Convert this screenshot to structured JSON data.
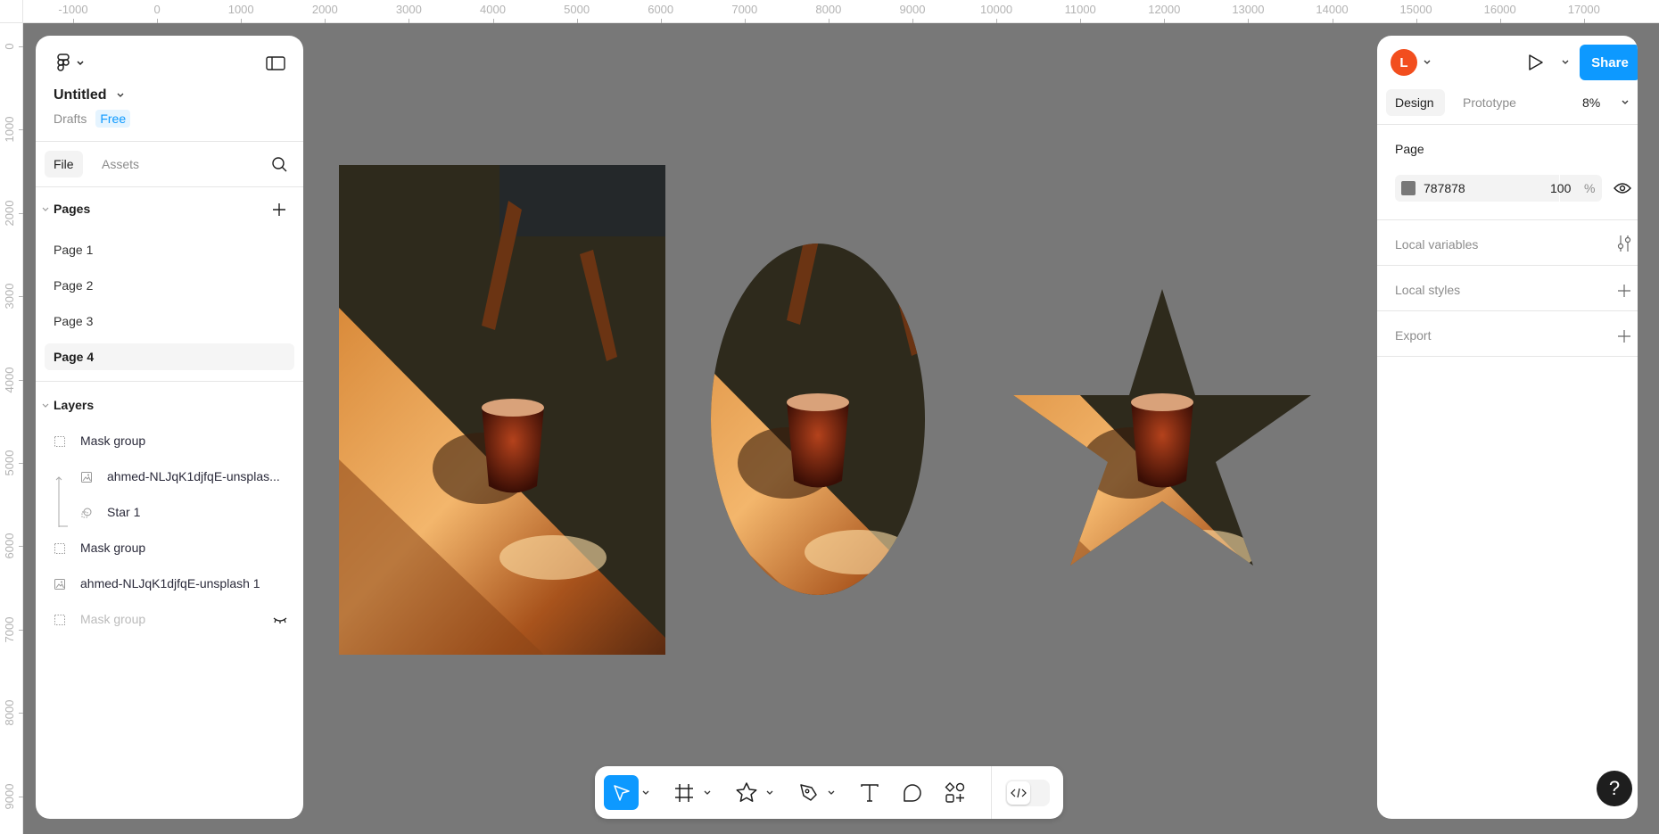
{
  "rulers": {
    "top": [
      "-1000",
      "0",
      "1000",
      "2000",
      "3000",
      "4000",
      "5000",
      "6000",
      "7000",
      "8000",
      "9000",
      "10000",
      "11000",
      "12000",
      "13000",
      "14000",
      "15000",
      "16000",
      "17000"
    ],
    "left": [
      "0",
      "1000",
      "2000",
      "3000",
      "4000",
      "5000",
      "6000",
      "7000",
      "8000",
      "9000"
    ]
  },
  "left_panel": {
    "file_name": "Untitled",
    "location": "Drafts",
    "plan_badge": "Free",
    "tabs": [
      {
        "label": "File",
        "active": true
      },
      {
        "label": "Assets",
        "active": false
      }
    ],
    "pages_title": "Pages",
    "pages": [
      {
        "label": "Page 1"
      },
      {
        "label": "Page 2"
      },
      {
        "label": "Page 3"
      },
      {
        "label": "Page 4",
        "selected": true
      }
    ],
    "layers_title": "Layers",
    "layers": [
      {
        "label": "Mask group",
        "icon": "mask-group-icon"
      },
      {
        "label": "ahmed-NLJqK1djfqE-unsplas...",
        "icon": "image-icon",
        "child": true
      },
      {
        "label": "Star 1",
        "icon": "mask-star-icon",
        "child": true
      },
      {
        "label": "Mask group",
        "icon": "mask-group-icon"
      },
      {
        "label": "ahmed-NLJqK1djfqE-unsplash 1",
        "icon": "image-icon"
      },
      {
        "label": "Mask group",
        "icon": "mask-group-icon",
        "hidden": true
      }
    ]
  },
  "right_panel": {
    "avatar_letter": "L",
    "avatar_color": "#f24e1e",
    "share_label": "Share",
    "share_color": "#0d99ff",
    "tabs": [
      {
        "label": "Design",
        "active": true
      },
      {
        "label": "Prototype",
        "active": false
      }
    ],
    "zoom": "8%",
    "page_section": "Page",
    "bg_color_hex": "787878",
    "bg_opacity": "100",
    "opacity_unit": "%",
    "sections": [
      {
        "label": "Local variables",
        "icon": "variables-icon"
      },
      {
        "label": "Local styles",
        "icon": "plus-icon"
      },
      {
        "label": "Export",
        "icon": "plus-icon"
      }
    ]
  },
  "toolbar": {
    "tools": [
      "move",
      "frame",
      "shape-star",
      "pen",
      "text",
      "comment",
      "actions",
      "dev-mode"
    ],
    "active": "move",
    "accent": "#0d99ff"
  },
  "help_label": "?",
  "canvas_bg": "#787878"
}
